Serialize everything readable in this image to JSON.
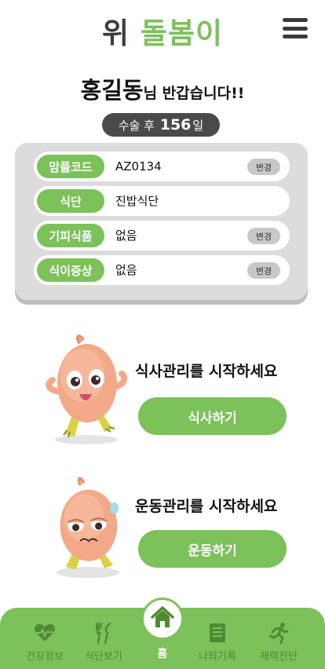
{
  "header": {
    "logo_part1": "위",
    "logo_part2": "돌봄이",
    "menu_icon": "hamburger-menu-icon"
  },
  "greeting": {
    "name": "홍길동",
    "message": "님 반갑습니다!!"
  },
  "surgery": {
    "prefix": "수술 후",
    "days": "156",
    "suffix": "일"
  },
  "info": {
    "rows": [
      {
        "label": "맘플코드",
        "value": "AZ0134",
        "button": "변경"
      },
      {
        "label": "식단",
        "value": "진밥식단"
      },
      {
        "label": "기피식품",
        "value": "없음",
        "button": "변경"
      },
      {
        "label": "식이증상",
        "value": "없음",
        "button": "변경"
      }
    ]
  },
  "actions": {
    "meal": {
      "title": "식사관리를 시작하세요",
      "button": "식사하기"
    },
    "exercise": {
      "title": "운동관리를 시작하세요",
      "button": "운동하기"
    }
  },
  "tabbar": {
    "items": [
      {
        "label": "건강정보",
        "icon": "heartbeat-icon"
      },
      {
        "label": "식단보기",
        "icon": "fork-knife-icon"
      },
      {
        "label": "홈",
        "icon": "home-icon"
      },
      {
        "label": "나의기록",
        "icon": "notebook-icon"
      },
      {
        "label": "체력진단",
        "icon": "running-icon"
      }
    ]
  },
  "colors": {
    "accent": "#7cc159",
    "dark": "#4a4a4a",
    "tab_inactive": "#4f8a33"
  }
}
